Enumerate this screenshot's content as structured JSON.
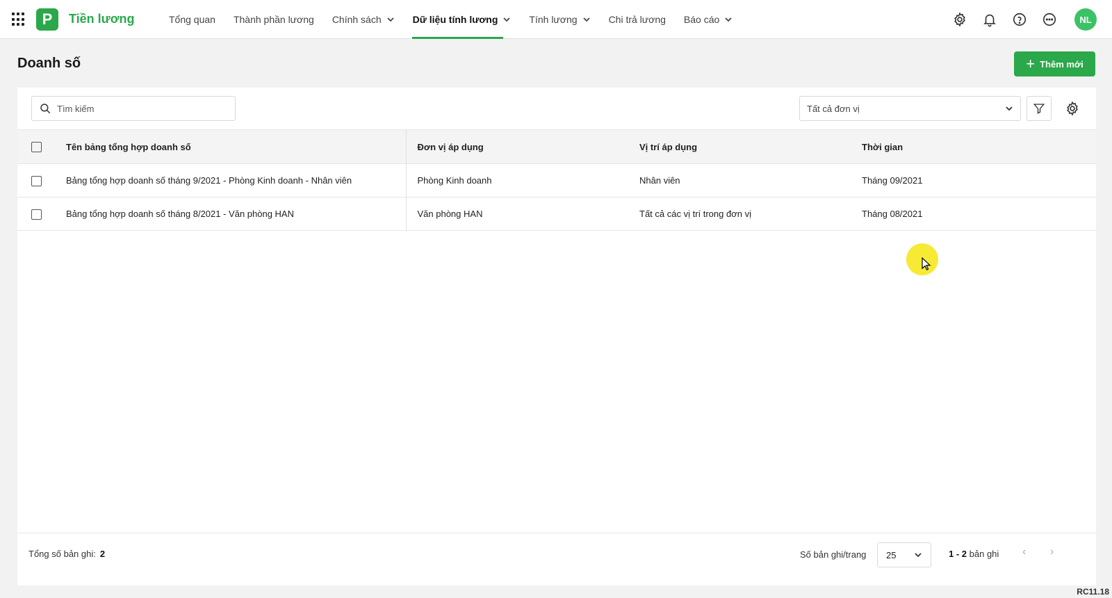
{
  "app": {
    "logo_letter": "P",
    "title": "Tiền lương",
    "brand_color": "#2aa84a"
  },
  "nav": {
    "items": [
      {
        "label": "Tổng quan",
        "dropdown": false,
        "active": false
      },
      {
        "label": "Thành phần lương",
        "dropdown": false,
        "active": false
      },
      {
        "label": "Chính sách",
        "dropdown": true,
        "active": false
      },
      {
        "label": "Dữ liệu tính lương",
        "dropdown": true,
        "active": true
      },
      {
        "label": "Tính lương",
        "dropdown": true,
        "active": false
      },
      {
        "label": "Chi trả lương",
        "dropdown": false,
        "active": false
      },
      {
        "label": "Báo cáo",
        "dropdown": true,
        "active": false
      }
    ]
  },
  "user": {
    "initials": "NL"
  },
  "page": {
    "title": "Doanh số",
    "add_label": "Thêm mới"
  },
  "toolbar": {
    "search_placeholder": "Tìm kiếm",
    "unit_filter_value": "Tất cả đơn vị"
  },
  "table": {
    "headers": [
      "Tên bảng tổng hợp doanh số",
      "Đơn vị áp dụng",
      "Vị trí áp dụng",
      "Thời gian"
    ],
    "rows": [
      [
        "Bảng tổng hợp doanh số tháng 9/2021 - Phòng Kinh doanh - Nhân viên",
        "Phòng Kinh doanh",
        "Nhân viên",
        "Tháng 09/2021"
      ],
      [
        "Bảng tổng hợp doanh số tháng 8/2021 - Văn phòng HAN",
        "Văn phòng HAN",
        "Tất cả các vị trí trong đơn vị",
        "Tháng 08/2021"
      ]
    ]
  },
  "footer": {
    "total_label": "Tổng số bản ghi:",
    "total_value": "2",
    "per_page_label": "Số bản ghi/trang",
    "per_page_value": "25",
    "range_value": "1 - 2",
    "range_label": "bản ghi"
  },
  "version": "RC11.18"
}
